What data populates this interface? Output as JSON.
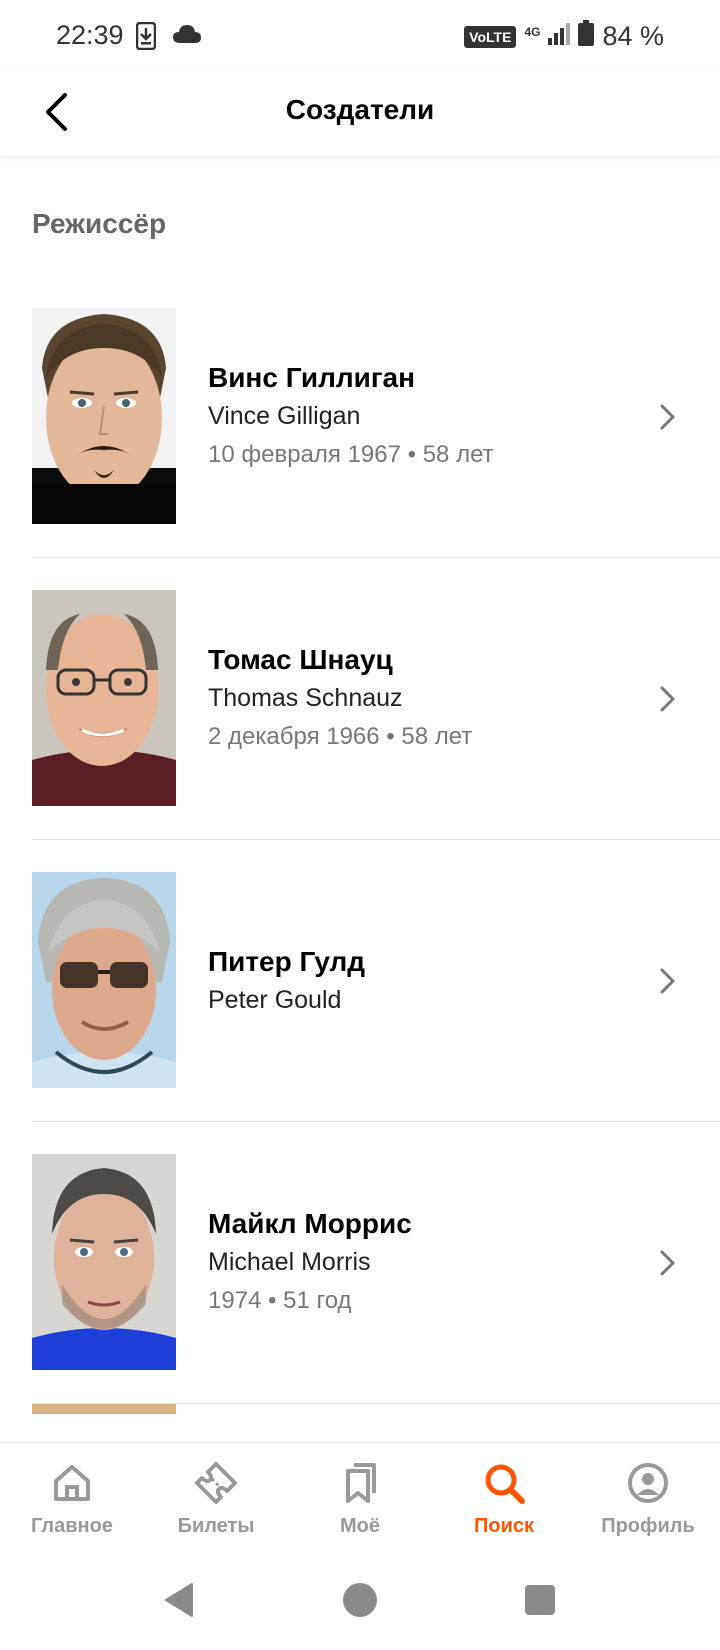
{
  "status_bar": {
    "time": "22:39",
    "battery_text": "84 %",
    "volte": "VoLTE",
    "network": "4G",
    "icons": [
      "download-icon",
      "cloud-icon",
      "signal-icon",
      "battery-icon"
    ]
  },
  "header": {
    "title": "Создатели",
    "back_icon": "back-arrow-icon"
  },
  "section": {
    "title": "Режиссёр"
  },
  "people": [
    {
      "name_ru": "Винс Гиллиган",
      "name_en": "Vince Gilligan",
      "born": "10 февраля 1967 • 58 лет"
    },
    {
      "name_ru": "Томас Шнауц",
      "name_en": "Thomas Schnauz",
      "born": "2 декабря 1966 • 58 лет"
    },
    {
      "name_ru": "Питер Гулд",
      "name_en": "Peter Gould",
      "born": ""
    },
    {
      "name_ru": "Майкл Моррис",
      "name_en": "Michael Morris",
      "born": "1974 • 51 год"
    }
  ],
  "bottom_nav": {
    "items": [
      {
        "label": "Главное",
        "icon": "home-icon"
      },
      {
        "label": "Билеты",
        "icon": "ticket-icon"
      },
      {
        "label": "Моё",
        "icon": "bookmark-icon"
      },
      {
        "label": "Поиск",
        "icon": "search-icon"
      },
      {
        "label": "Профиль",
        "icon": "profile-icon"
      }
    ],
    "active": "Поиск"
  },
  "colors": {
    "accent": "#ff5500",
    "inactive": "#999999",
    "section_title": "#666666",
    "divider": "#e3e3e3"
  }
}
